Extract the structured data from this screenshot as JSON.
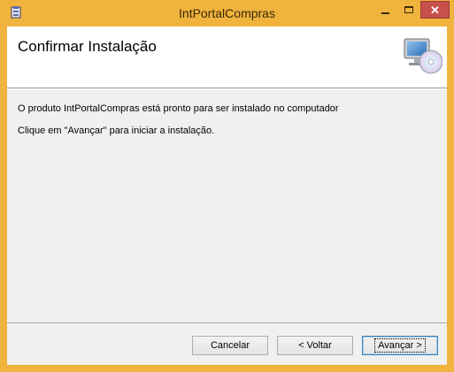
{
  "window": {
    "title": "IntPortalCompras",
    "frame_color": "#f0b33e",
    "close_color": "#c7504b"
  },
  "titlebar": {
    "app_icon": "installer-icon",
    "minimize_glyph": "minimize-icon",
    "maximize_glyph": "maximize-icon",
    "close_glyph": "✕"
  },
  "banner": {
    "title": "Confirmar Instalação",
    "image": "computer-cd-icon"
  },
  "body": {
    "line1": "O produto IntPortalCompras está pronto para ser instalado no computador",
    "line2": "Clique em \"Avançar\" para iniciar a instalação."
  },
  "buttons": {
    "cancel": "Cancelar",
    "back": "< Voltar",
    "next": "Avançar >"
  }
}
